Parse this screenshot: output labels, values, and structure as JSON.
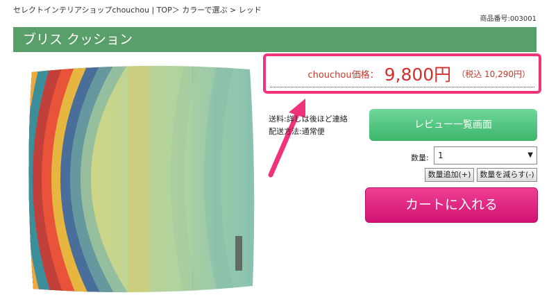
{
  "breadcrumb": "セレクトインテリアショップchouchou | TOP＞ カラーで選ぶ > レッド",
  "product_code": "商品番号:003001",
  "title": "ブリス クッション",
  "price": {
    "label": "chouchou価格：",
    "value": "9,800円",
    "tax": "（税込 10,290円）"
  },
  "shipping": {
    "fee": "送料:詳しは後ほど連絡",
    "method": "配送方法:通常便"
  },
  "buttons": {
    "review": "レビュー一覧画面",
    "cart": "カートに入れる",
    "qty_add": "数量追加(+)",
    "qty_sub": "数量を減らす(-)"
  },
  "quantity": {
    "label": "数量:",
    "selected": "1"
  },
  "colors": {
    "title_bar": "#5a9e6a",
    "price_border": "#f0327a",
    "price_text": "#d62d2d",
    "review_button": "#4cc27c",
    "cart_button": "#e0287f"
  },
  "icons": {
    "arrow": "pink-arrow-icon",
    "dropdown": "chevron-down-icon"
  }
}
